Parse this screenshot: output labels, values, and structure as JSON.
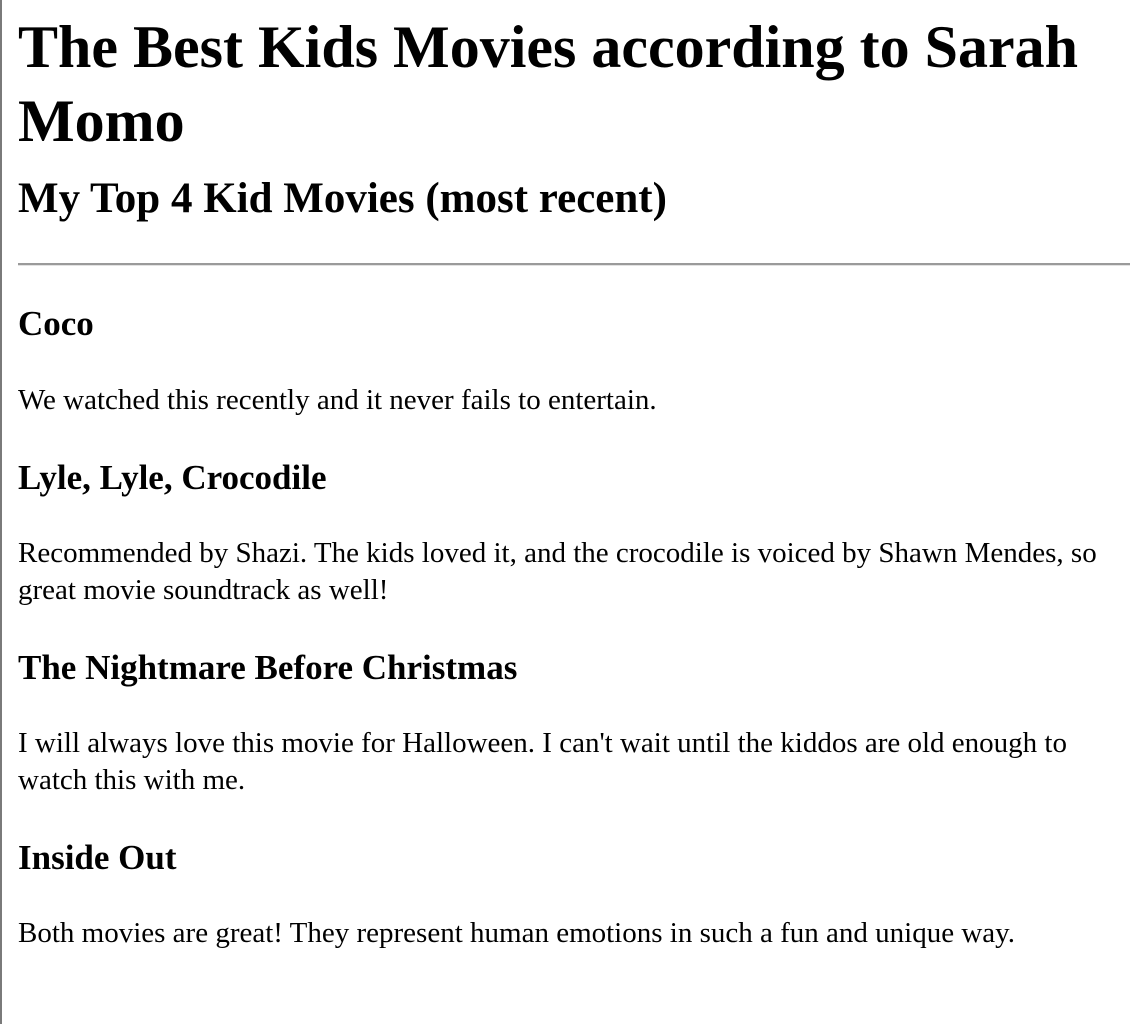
{
  "page": {
    "title": "The Best Kids Movies according to Sarah Momo",
    "subtitle": "My Top 4 Kid Movies (most recent)"
  },
  "movies": [
    {
      "title": "Coco",
      "description": "We watched this recently and it never fails to entertain."
    },
    {
      "title": "Lyle, Lyle, Crocodile",
      "description": "Recommended by Shazi. The kids loved it, and the crocodile is voiced by Shawn Mendes, so great movie soundtrack as well!"
    },
    {
      "title": "The Nightmare Before Christmas",
      "description": "I will always love this movie for Halloween. I can't wait until the kiddos are old enough to watch this with me."
    },
    {
      "title": "Inside Out",
      "description": "Both movies are great! They represent human emotions in such a fun and unique way."
    }
  ]
}
